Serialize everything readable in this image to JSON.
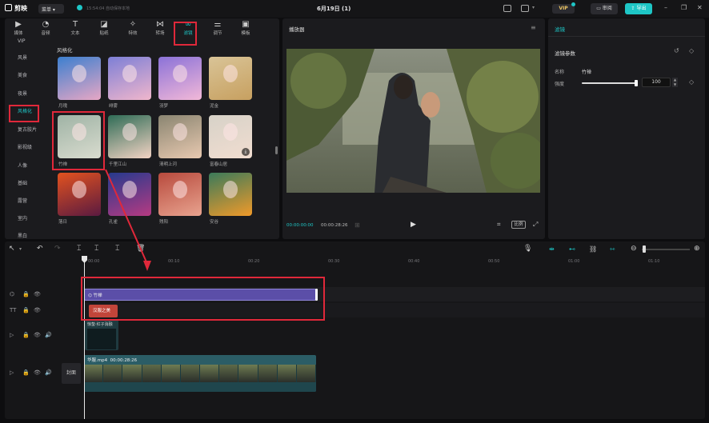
{
  "titlebar": {
    "app_name": "剪映",
    "menu_label": "菜单",
    "save_status": "15:54:04 自动保存本地",
    "project_title": "6月19日 (1)",
    "vip_label": "VIP",
    "review_label": "审阅",
    "export_label": "导出"
  },
  "tabs": [
    {
      "label": "媒体",
      "icon": "media-icon"
    },
    {
      "label": "音频",
      "icon": "audio-icon"
    },
    {
      "label": "文本",
      "icon": "text-icon"
    },
    {
      "label": "贴纸",
      "icon": "sticker-icon"
    },
    {
      "label": "特效",
      "icon": "effects-icon"
    },
    {
      "label": "转场",
      "icon": "transition-icon"
    },
    {
      "label": "滤镜",
      "icon": "filter-icon",
      "active": true
    },
    {
      "label": "调节",
      "icon": "adjust-icon"
    },
    {
      "label": "模板",
      "icon": "template-icon"
    }
  ],
  "categories": [
    "VIP",
    "风景",
    "美食",
    "夜景",
    "风格化",
    "复古胶片",
    "影视级",
    "人像",
    "基础",
    "露营",
    "室内",
    "黑白"
  ],
  "active_category": "风格化",
  "section_title": "风格化",
  "filters": [
    {
      "label": "月瑰"
    },
    {
      "label": "绯雾"
    },
    {
      "label": "羽梦"
    },
    {
      "label": "泥金"
    },
    {
      "label": "竹禅"
    },
    {
      "label": "千里江山"
    },
    {
      "label": "清明上河"
    },
    {
      "label": "富春山居"
    },
    {
      "label": "落日"
    },
    {
      "label": "孔雀"
    },
    {
      "label": "残阳"
    },
    {
      "label": "安谷"
    }
  ],
  "player": {
    "title": "播放器",
    "current_time": "00:00:00:00",
    "total_time": "00:00:28:26",
    "ratio_label": "比例"
  },
  "inspector": {
    "tab_label": "滤镜",
    "section_label": "滤镜参数",
    "name_label": "名称",
    "name_value": "竹禅",
    "strength_label": "强度",
    "strength_value": "100",
    "strength_fraction": 1.0
  },
  "timeline": {
    "ruler": [
      "00:00",
      "00:10",
      "00:20",
      "00:30",
      "00:40",
      "00:50",
      "01:00",
      "01:10"
    ],
    "filter_clip_label": "竹禅",
    "text_clip_label": "汉服之美",
    "audio_clip_label": "惊蛰·红子消融",
    "video_clip_label": "华服.mp4",
    "video_clip_duration": "00:00:28:26",
    "cover_label": "封面"
  },
  "colors": {
    "accent": "#1ec6c6",
    "annotation_red": "#e0283a",
    "filter_clip": "#5b4ea8",
    "text_clip": "#c2453a",
    "video_clip": "#2b5d66"
  }
}
